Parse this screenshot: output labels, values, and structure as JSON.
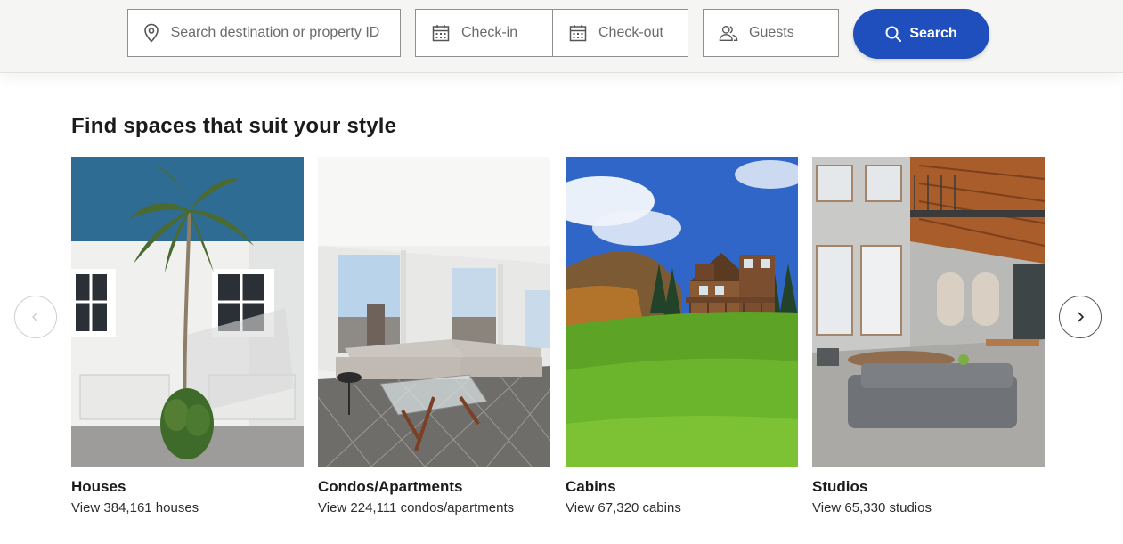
{
  "search": {
    "destination_placeholder": "Search destination or property ID",
    "checkin_label": "Check-in",
    "checkout_label": "Check-out",
    "guests_label": "Guests",
    "button_label": "Search"
  },
  "section": {
    "heading": "Find spaces that suit your style"
  },
  "cards": [
    {
      "title": "Houses",
      "subtitle": "View 384,161 houses",
      "image": "white-house-palm-tree-photo"
    },
    {
      "title": "Condos/Apartments",
      "subtitle": "View 224,111 condos/apartments",
      "image": "living-room-city-view-photo"
    },
    {
      "title": "Cabins",
      "subtitle": "View 67,320 cabins",
      "image": "wooden-cabin-mountain-meadow-photo"
    },
    {
      "title": "Studios",
      "subtitle": "View 65,330 studios",
      "image": "loft-studio-brick-interior-photo"
    }
  ],
  "carousel": {
    "prev_icon": "chevron-left-icon",
    "next_icon": "chevron-right-icon"
  },
  "colors": {
    "accent": "#1e4fbd",
    "topbar_bg": "#f5f5f4",
    "text": "#1b1b1b"
  }
}
